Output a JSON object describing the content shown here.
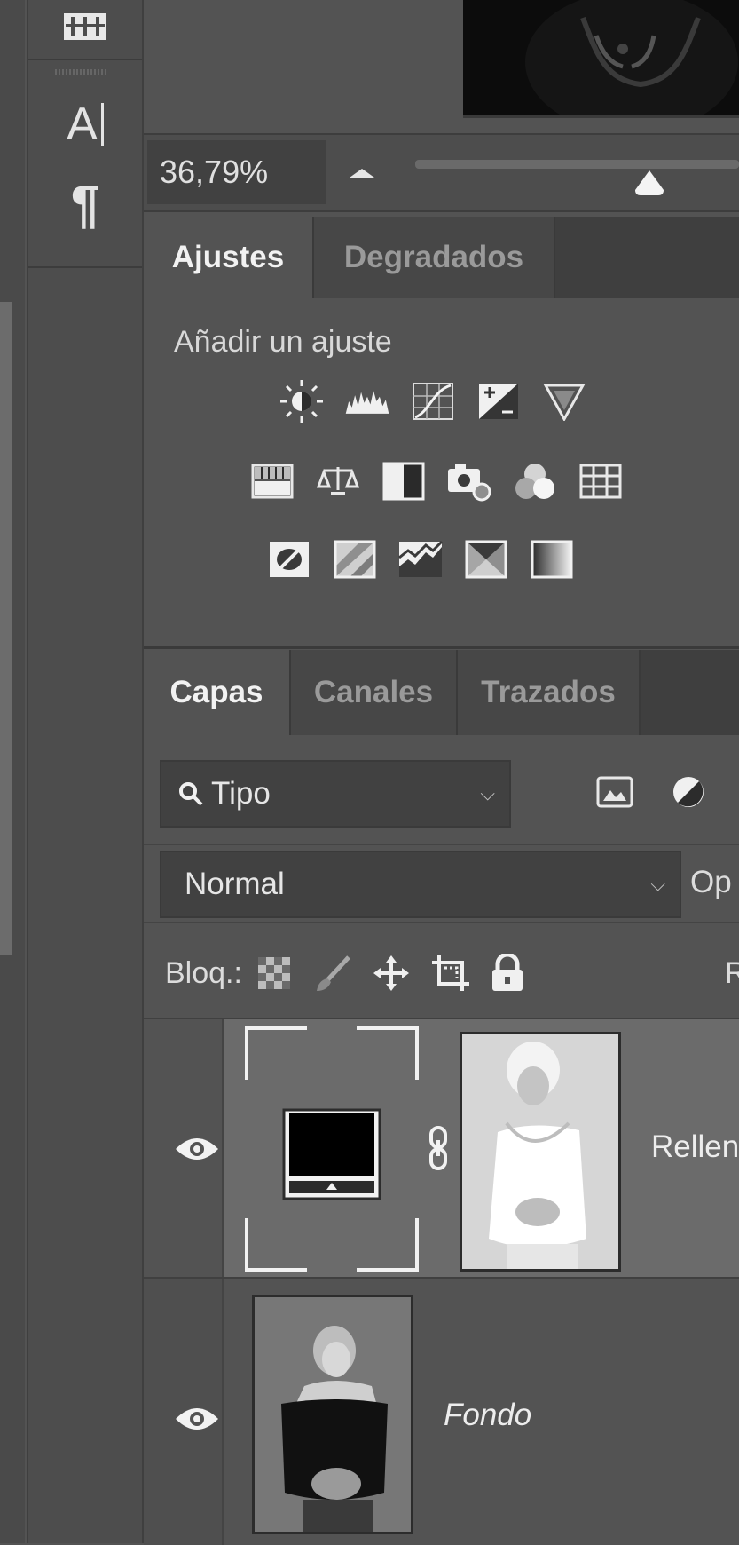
{
  "toolbar": {
    "tools": [
      {
        "name": "grid-tool",
        "glyph": "▦"
      },
      {
        "name": "type-tool",
        "glyph": "A|"
      },
      {
        "name": "paragraph-tool",
        "glyph": "¶"
      }
    ]
  },
  "navigator": {
    "zoom_value": "36,79%",
    "zoom_level_fraction": 0.71
  },
  "adjustments_panel": {
    "tabs": [
      {
        "label": "Ajustes",
        "active": true
      },
      {
        "label": "Degradados",
        "active": false
      }
    ],
    "caption": "Añadir un ajuste",
    "icons": [
      [
        "brightness-contrast-icon",
        "levels-icon",
        "curves-icon",
        "exposure-icon",
        "vibrance-icon"
      ],
      [
        "hue-saturation-icon",
        "color-balance-icon",
        "black-white-icon",
        "photo-filter-icon",
        "channel-mixer-icon",
        "color-lookup-icon"
      ],
      [
        "invert-icon",
        "posterize-icon",
        "threshold-icon",
        "selective-color-icon",
        "gradient-map-icon"
      ]
    ]
  },
  "layers_panel": {
    "tabs": [
      {
        "label": "Capas",
        "active": true
      },
      {
        "label": "Canales",
        "active": false
      },
      {
        "label": "Trazados",
        "active": false
      }
    ],
    "filter": {
      "label": "Tipo"
    },
    "blend_mode": {
      "value": "Normal",
      "opacity_label": "Op"
    },
    "lock": {
      "label": "Bloq.:",
      "fill_label": "R"
    },
    "layers": [
      {
        "name": "Rellen",
        "visible": true,
        "selected": true,
        "italic": false
      },
      {
        "name": "Fondo",
        "visible": true,
        "selected": false,
        "italic": true
      }
    ]
  },
  "colors": {
    "panel_bg": "#535353",
    "tab_bg": "#3f3f3f",
    "field_bg": "#414141",
    "selected_layer": "#6b6b6b"
  }
}
